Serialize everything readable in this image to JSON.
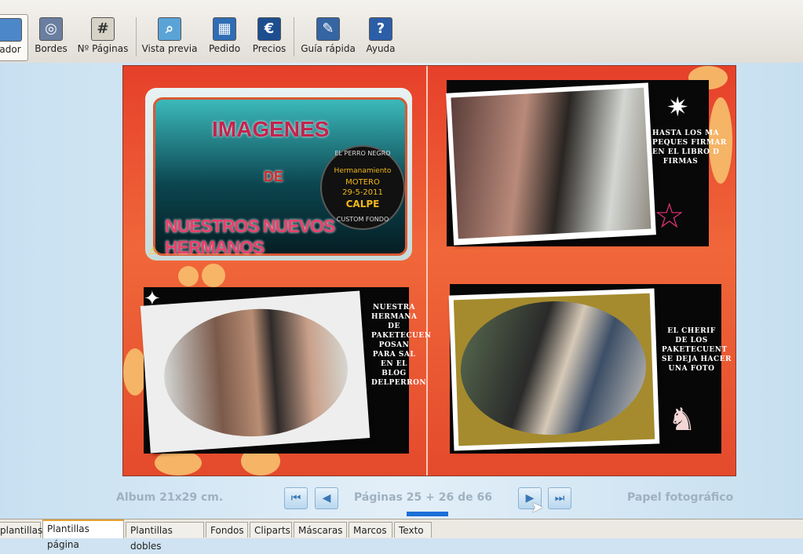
{
  "toolbar": {
    "buttons": [
      {
        "label": "ador",
        "icon": "organizer-icon"
      },
      {
        "label": "Bordes",
        "icon": "borders-icon"
      },
      {
        "label": "Nº Páginas",
        "icon": "page-count-icon"
      },
      {
        "label": "Vista previa",
        "icon": "preview-icon"
      },
      {
        "label": "Pedido",
        "icon": "cart-icon"
      },
      {
        "label": "Precios",
        "icon": "euro-icon"
      },
      {
        "label": "Guía rápida",
        "icon": "quick-guide-icon"
      },
      {
        "label": "Ayuda",
        "icon": "help-icon"
      }
    ]
  },
  "album": {
    "title_lines": [
      "IMAGENES",
      "DE",
      "NUESTROS NUEVOS HERMANOS"
    ],
    "stamp": {
      "lines": [
        "Hermanamiento",
        "MOTERO",
        "29-5-2011",
        "CALPE"
      ],
      "ring_left": "CUSTOM FONDO",
      "ring_right": "EL PERRO NEGRO"
    },
    "captions": [
      "HASTA LOS MA\nPEQUES FIRMAR\nEN EL LIBRO D\nFIRMAS",
      "NUESTRA\nHERMANA\nDE\nPAKETECUEN\nPOSAN\nPARA SAL\nEN EL\nBLOG\nDELPERRON",
      "EL CHERIF\nDE LOS\nPAKETECUENT\nSE DEJA HACER\nUNA FOTO"
    ]
  },
  "footer": {
    "album_size": "Album 21x29 cm.",
    "pages": "Páginas 25 + 26 de 66",
    "paper": "Papel fotográfico"
  },
  "nav": {
    "first": "first-page-icon",
    "prev": "prev-page-icon",
    "next": "next-page-icon",
    "last": "last-page-icon"
  },
  "tabs": [
    "plantillas",
    "Plantillas página",
    "Plantillas dobles",
    "Fondos",
    "Cliparts",
    "Máscaras",
    "Marcos",
    "Texto"
  ],
  "colors": {
    "accent_tab": "#e6a133",
    "page_bg": "#e6402a",
    "nav_blue": "#3a78b5"
  }
}
